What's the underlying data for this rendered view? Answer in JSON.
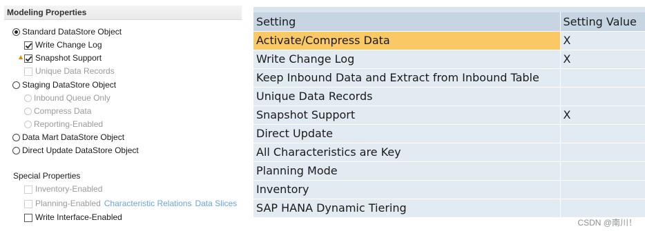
{
  "left": {
    "modeling_header": "Modeling Properties",
    "standard_dso": "Standard DataStore Object",
    "write_change_log": "Write Change Log",
    "snapshot_support": "Snapshot Support",
    "unique_data_records": "Unique Data Records",
    "staging_dso": "Staging DataStore Object",
    "inbound_queue_only": "Inbound Queue Only",
    "compress_data": "Compress Data",
    "reporting_enabled": "Reporting-Enabled",
    "data_mart_dso": "Data Mart DataStore Object",
    "direct_update_dso": "Direct Update DataStore Object",
    "special_header": "Special Properties",
    "inventory_enabled": "Inventory-Enabled",
    "planning_enabled": "Planning-Enabled",
    "characteristic_relations": "Characteristic Relations",
    "data_slices": "Data Slices",
    "write_interface_enabled": "Write Interface-Enabled"
  },
  "table": {
    "headers": [
      "Setting",
      "Setting Value"
    ],
    "rows": [
      {
        "setting": "Activate/Compress Data",
        "value": "X"
      },
      {
        "setting": "Write Change Log",
        "value": "X"
      },
      {
        "setting": "Keep Inbound Data and Extract from Inbound Table",
        "value": ""
      },
      {
        "setting": "Unique Data Records",
        "value": ""
      },
      {
        "setting": "Snapshot Support",
        "value": "X"
      },
      {
        "setting": "Direct Update",
        "value": ""
      },
      {
        "setting": "All Characteristics are Key",
        "value": ""
      },
      {
        "setting": "Planning Mode",
        "value": ""
      },
      {
        "setting": "Inventory",
        "value": ""
      },
      {
        "setting": "SAP HANA Dynamic Tiering",
        "value": ""
      }
    ]
  },
  "watermark": "CSDN @南川！",
  "colors": {
    "selected_row": "#fbc866",
    "header_bg": "#c7d5e3",
    "row_bg": "#e2eaf2",
    "link": "#6aa4e0"
  }
}
